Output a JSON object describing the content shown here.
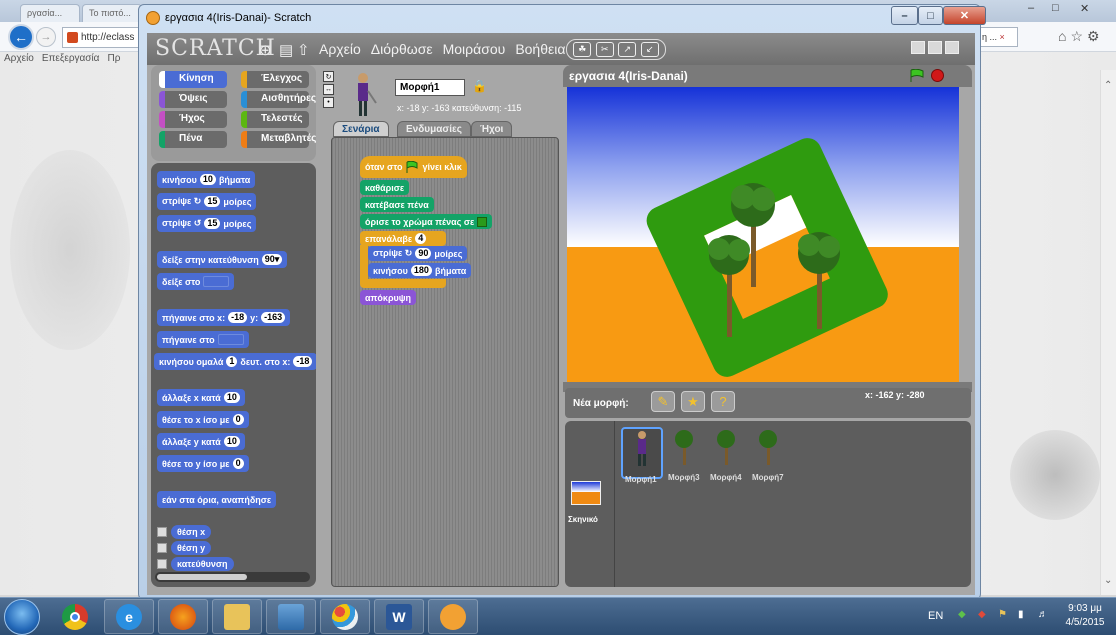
{
  "browser": {
    "tabs": [
      "ργασία...",
      "Το πιστό..."
    ],
    "address": "http://eclass",
    "menu": [
      "Αρχείο",
      "Επεξεργασία",
      "Πρ"
    ],
    "right_tab": "η ...",
    "close_tab_glyph": "×",
    "window_controls": [
      "–",
      "□",
      "✕"
    ]
  },
  "window": {
    "title": "εργασια 4(Iris-Danai)- Scratch",
    "min": "–",
    "max": "□",
    "close": "✕"
  },
  "scratch": {
    "logo": "SCRATCH",
    "menu": [
      "Αρχείο",
      "Διόρθωσε",
      "Μοιράσου",
      "Βοήθεια"
    ],
    "categories": [
      {
        "label": "Κίνηση",
        "color": "#4a6cd4",
        "active": true
      },
      {
        "label": "Έλεγχος",
        "color": "#e6a51f"
      },
      {
        "label": "Όψεις",
        "color": "#8b55d6"
      },
      {
        "label": "Αισθητήρες",
        "color": "#2a8fd6"
      },
      {
        "label": "Ήχος",
        "color": "#c44fc4"
      },
      {
        "label": "Τελεστές",
        "color": "#5cb712"
      },
      {
        "label": "Πένα",
        "color": "#13a367"
      },
      {
        "label": "Μεταβλητές",
        "color": "#ee7d16"
      }
    ],
    "palette": {
      "move_pre": "κινήσου",
      "move_val": "10",
      "move_post": "βήματα",
      "turn_cw_pre": "στρίψε ↻",
      "turn_cw_val": "15",
      "turn_cw_post": "μοίρες",
      "turn_ccw_pre": "στρίψε ↺",
      "turn_ccw_val": "15",
      "turn_ccw_post": "μοίρες",
      "point_dir": "δείξε στην κατεύθυνση",
      "point_dir_val": "90▾",
      "point_to": "δείξε στο",
      "goto_xy": "πήγαινε στο x:",
      "goto_x": "-18",
      "goto_ylabel": "y:",
      "goto_y": "-163",
      "goto": "πήγαινε στο",
      "glide_pre": "κινήσου ομαλά",
      "glide_secs": "1",
      "glide_mid": "δευτ. στο x:",
      "glide_x": "-18",
      "change_x": "άλλαξε x κατά",
      "change_x_val": "10",
      "set_x": "θέσε το x ίσο με",
      "set_x_val": "0",
      "change_y": "άλλαξε y κατά",
      "change_y_val": "10",
      "set_y": "θέσε το y ίσο με",
      "set_y_val": "0",
      "bounce": "εάν στα όρια, αναπήδησε",
      "rep_x": "θέση x",
      "rep_y": "θέση y",
      "rep_dir": "κατεύθυνση"
    },
    "sprite": {
      "name": "Μορφή1",
      "coords": "x: -18  y: -163  κατεύθυνση: -115"
    },
    "tabs": [
      "Σενάρια",
      "Ενδυμασίες",
      "Ήχοι"
    ],
    "script": {
      "hat_pre": "όταν στο",
      "hat_post": "γίνει κλικ",
      "clear": "καθάρισε",
      "pen_down": "κατέβασε πένα",
      "set_color": "όρισε το χρώμα πένας σε",
      "repeat": "επανάλαβε",
      "repeat_val": "4",
      "turn_pre": "στρίψε ↻",
      "turn_val": "90",
      "turn_post": "μοίρες",
      "move_pre": "κινήσου",
      "move_val": "180",
      "move_post": "βήματα",
      "hide": "απόκρυψη"
    },
    "stage": {
      "title": "εργασια 4(Iris-Danai)",
      "mouse_xy": "x: -162   y: -280"
    },
    "new_sprite_label": "Νέα μορφή:",
    "sprites": [
      "Μορφή1",
      "Μορφή3",
      "Μορφή4",
      "Μορφή7"
    ],
    "stage_label": "Σκηνικό"
  },
  "taskbar": {
    "apps": [
      "windows-start",
      "chrome",
      "internet-explorer",
      "firefox",
      "file-explorer",
      "photos",
      "paint",
      "word",
      "scratch"
    ],
    "word_glyph": "W",
    "lang": "EN",
    "time": "9:03 μμ",
    "date": "4/5/2015"
  }
}
